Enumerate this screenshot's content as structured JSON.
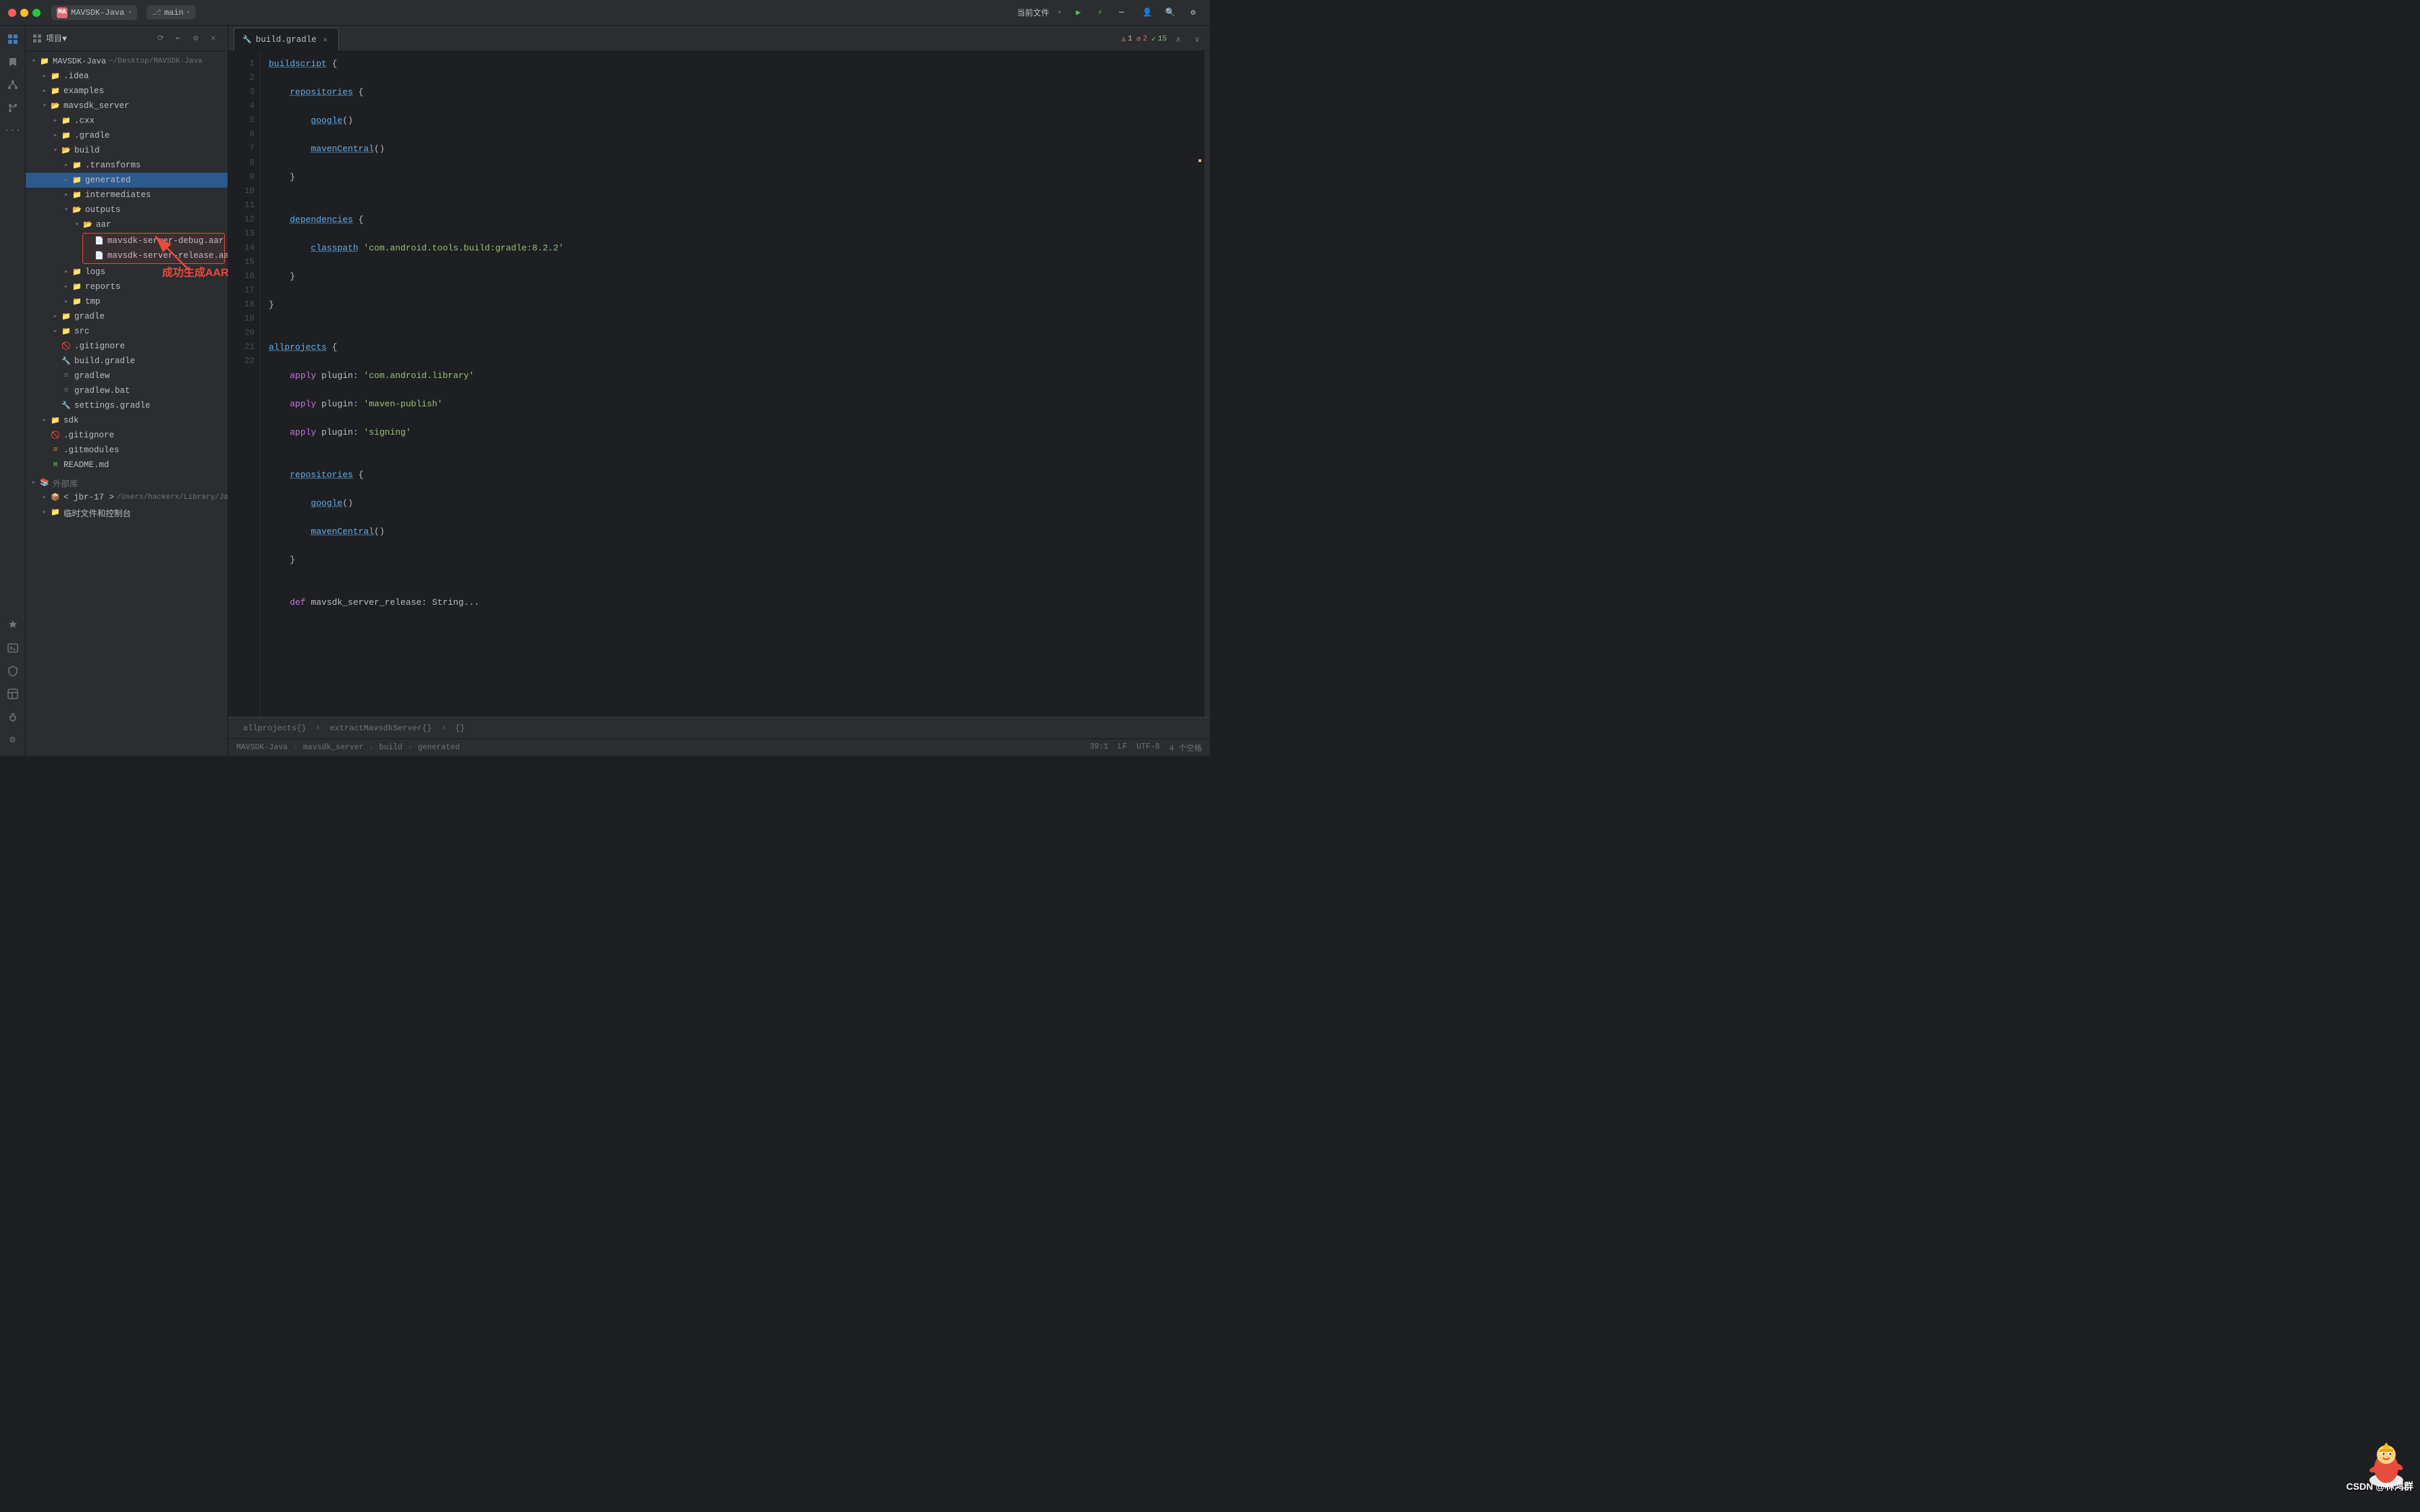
{
  "titlebar": {
    "project_name": "MAVSDK-Java",
    "branch": "main",
    "current_file_label": "当前文件",
    "run_button": "▶",
    "debug_button": "🐞",
    "more_button": "⋯",
    "search_button": "🔍",
    "profile_button": "👤",
    "settings_button": "⚙"
  },
  "file_tree": {
    "panel_title": "项目▼",
    "root": {
      "name": "MAVSDK-Java",
      "path": "~/Desktop/MAVSDK-Java",
      "children": [
        {
          "id": "idea",
          "name": ".idea",
          "type": "folder",
          "expanded": false,
          "level": 1
        },
        {
          "id": "examples",
          "name": "examples",
          "type": "folder",
          "expanded": false,
          "level": 1
        },
        {
          "id": "mavsdk_server",
          "name": "mavsdk_server",
          "type": "folder",
          "expanded": true,
          "level": 1,
          "children": [
            {
              "id": "cxx",
              "name": ".cxx",
              "type": "folder",
              "expanded": false,
              "level": 2
            },
            {
              "id": "gradle_dir",
              "name": ".gradle",
              "type": "folder",
              "expanded": false,
              "level": 2
            },
            {
              "id": "build",
              "name": "build",
              "type": "folder",
              "expanded": true,
              "level": 2,
              "children": [
                {
                  "id": "transforms",
                  "name": ".transforms",
                  "type": "folder",
                  "expanded": false,
                  "level": 3
                },
                {
                  "id": "generated",
                  "name": "generated",
                  "type": "folder",
                  "expanded": false,
                  "level": 3,
                  "selected": true
                },
                {
                  "id": "intermediates",
                  "name": "intermediates",
                  "type": "folder",
                  "expanded": false,
                  "level": 3
                },
                {
                  "id": "outputs",
                  "name": "outputs",
                  "type": "folder",
                  "expanded": true,
                  "level": 3,
                  "children": [
                    {
                      "id": "aar",
                      "name": "aar",
                      "type": "folder",
                      "expanded": true,
                      "level": 4,
                      "children": [
                        {
                          "id": "mavsdk_debug",
                          "name": "mavsdk-server-debug.aar",
                          "type": "aar",
                          "level": 5,
                          "highlighted": true
                        },
                        {
                          "id": "mavsdk_release",
                          "name": "mavsdk-server-release.aar",
                          "type": "aar",
                          "level": 5,
                          "highlighted": true
                        }
                      ]
                    }
                  ]
                },
                {
                  "id": "logs",
                  "name": "logs",
                  "type": "folder",
                  "expanded": false,
                  "level": 3
                },
                {
                  "id": "reports",
                  "name": "reports",
                  "type": "folder",
                  "expanded": false,
                  "level": 3
                },
                {
                  "id": "tmp",
                  "name": "tmp",
                  "type": "folder",
                  "expanded": false,
                  "level": 3
                }
              ]
            },
            {
              "id": "gradle_dir2",
              "name": "gradle",
              "type": "folder",
              "expanded": false,
              "level": 2
            },
            {
              "id": "src",
              "name": "src",
              "type": "folder",
              "expanded": false,
              "level": 2
            },
            {
              "id": "gitignore",
              "name": ".gitignore",
              "type": "gitignore",
              "level": 2
            },
            {
              "id": "build_gradle",
              "name": "build.gradle",
              "type": "gradle",
              "level": 2
            },
            {
              "id": "gradlew",
              "name": "gradlew",
              "type": "gradlew",
              "level": 2
            },
            {
              "id": "gradlew_bat",
              "name": "gradlew.bat",
              "type": "gradlew",
              "level": 2
            },
            {
              "id": "settings_gradle",
              "name": "settings.gradle",
              "type": "gradle",
              "level": 2
            }
          ]
        },
        {
          "id": "sdk",
          "name": "sdk",
          "type": "folder",
          "expanded": false,
          "level": 1
        },
        {
          "id": "root_gitignore",
          "name": ".gitignore",
          "type": "gitignore",
          "level": 1
        },
        {
          "id": "root_gitmodules",
          "name": ".gitmodules",
          "type": "gitignore",
          "level": 1
        },
        {
          "id": "readme",
          "name": "README.md",
          "type": "md",
          "level": 1
        },
        {
          "id": "ext_libs_label",
          "name": "外部库",
          "type": "section",
          "level": 0
        },
        {
          "id": "jbr17",
          "name": "< jbr-17 >",
          "type": "folder",
          "expanded": false,
          "level": 1,
          "path": "/Users/hackerx/Library/Java/JavaVirtualMa..."
        },
        {
          "id": "temp_files",
          "name": "临时文件和控制台",
          "type": "folder",
          "expanded": false,
          "level": 1
        }
      ]
    }
  },
  "annotation": {
    "text": "成功生成AAR",
    "color": "#e74c3c"
  },
  "editor": {
    "tab_label": "build.gradle",
    "warnings": "⚠ 1",
    "errors": "⊘ 2",
    "ok": "✓ 15",
    "lines": [
      {
        "num": 1,
        "code": "buildscript {"
      },
      {
        "num": 2,
        "code": "    repositories {"
      },
      {
        "num": 3,
        "code": "        google()"
      },
      {
        "num": 4,
        "code": "        mavenCentral()"
      },
      {
        "num": 5,
        "code": "    }"
      },
      {
        "num": 6,
        "code": ""
      },
      {
        "num": 7,
        "code": "    dependencies {"
      },
      {
        "num": 8,
        "code": "        classpath 'com.android.tools.build:gradle:8.2.2'"
      },
      {
        "num": 9,
        "code": "    }"
      },
      {
        "num": 10,
        "code": "}"
      },
      {
        "num": 11,
        "code": ""
      },
      {
        "num": 12,
        "code": "allprojects {"
      },
      {
        "num": 13,
        "code": "    apply plugin: 'com.android.library'"
      },
      {
        "num": 14,
        "code": "    apply plugin: 'maven-publish'"
      },
      {
        "num": 15,
        "code": "    apply plugin: 'signing'"
      },
      {
        "num": 16,
        "code": ""
      },
      {
        "num": 17,
        "code": "    repositories {"
      },
      {
        "num": 18,
        "code": "        google()"
      },
      {
        "num": 19,
        "code": "        mavenCentral()"
      },
      {
        "num": 20,
        "code": "    }"
      },
      {
        "num": 21,
        "code": ""
      },
      {
        "num": 22,
        "code": "    def mavsdk_server_release: String..."
      }
    ]
  },
  "bottom_bar": {
    "breadcrumb": "allprojects{}",
    "breadcrumb2": "extractMavsdkServer{}",
    "breadcrumb3": "{}",
    "project_label": "MAVSDK-Java",
    "path1": "mavsdk_server",
    "path2": "build",
    "path3": "generated",
    "position": "39:1",
    "line_sep": "LF",
    "encoding": "UTF-8",
    "indent": "4 个空格"
  },
  "watermark": "CSDN @林鸿群"
}
